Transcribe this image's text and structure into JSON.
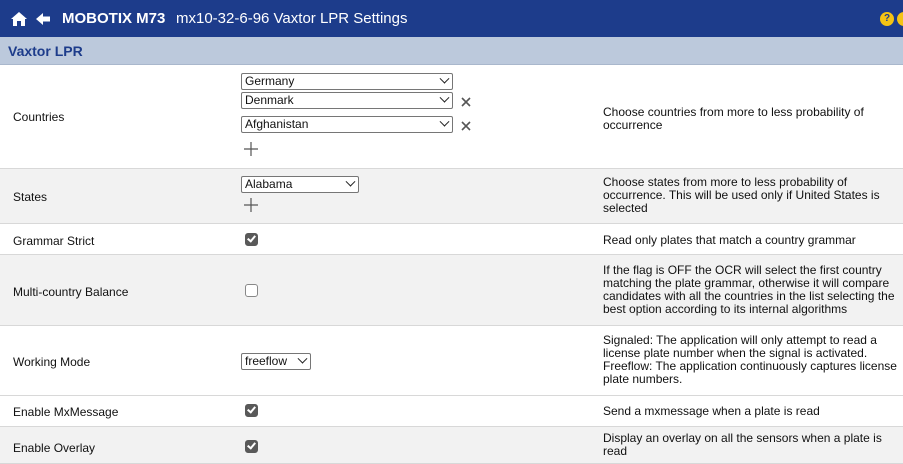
{
  "header": {
    "app_title": "MOBOTIX M73",
    "page_title": "mx10-32-6-96 Vaxtor LPR Settings",
    "help_icon": "question-icon",
    "info_icon": "info-icon"
  },
  "section": {
    "title": "Vaxtor LPR"
  },
  "rows": {
    "countries": {
      "label": "Countries",
      "selects": [
        "Germany",
        "Denmark",
        "Afghanistan"
      ],
      "desc": "Choose countries from more to less probability of occurrence"
    },
    "states": {
      "label": "States",
      "select": "Alabama",
      "desc": "Choose states from more to less probability of occurrence. This will be used only if United States is selected"
    },
    "grammar_strict": {
      "label": "Grammar Strict",
      "checked": true,
      "desc": "Read only plates that match a country grammar"
    },
    "multi_country": {
      "label": "Multi-country Balance",
      "checked": false,
      "desc": "If the flag is OFF the OCR will select the first country matching the plate grammar, otherwise it will compare candidates with all the countries in the list selecting the best option according to its internal algorithms"
    },
    "working_mode": {
      "label": "Working Mode",
      "select": "freeflow",
      "desc": "Signaled: The application will only attempt to read a license plate number when the signal is activated. Freeflow: The application continuously captures license plate numbers."
    },
    "mxmessage": {
      "label": "Enable MxMessage",
      "checked": true,
      "desc": "Send a mxmessage when a plate is read"
    },
    "overlay": {
      "label": "Enable Overlay",
      "checked": true,
      "desc": "Display an overlay on all the sensors when a plate is read"
    }
  },
  "colors": {
    "header_bg": "#1d3c8b",
    "section_bg": "#bcc9dc",
    "accent": "#f4c314"
  }
}
